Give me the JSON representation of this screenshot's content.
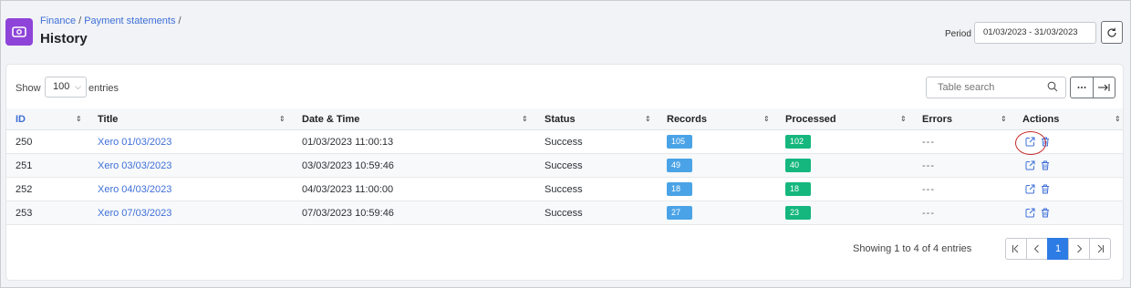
{
  "header": {
    "breadcrumb": [
      "Finance",
      "Payment statements"
    ],
    "title": "History",
    "period_label": "Period",
    "period_value": "01/03/2023 - 31/03/2023"
  },
  "toolbar": {
    "show_label": "Show",
    "entries_value": "100",
    "entries_label": "entries",
    "search_placeholder": "Table search"
  },
  "table": {
    "columns": [
      "ID",
      "Title",
      "Date & Time",
      "Status",
      "Records",
      "Processed",
      "Errors",
      "Actions"
    ],
    "rows": [
      {
        "id": "250",
        "title": "Xero 01/03/2023",
        "datetime": "01/03/2023 11:00:13",
        "status": "Success",
        "records": "105",
        "processed": "102",
        "errors": "---"
      },
      {
        "id": "251",
        "title": "Xero 03/03/2023",
        "datetime": "03/03/2023 10:59:46",
        "status": "Success",
        "records": "49",
        "processed": "40",
        "errors": "---"
      },
      {
        "id": "252",
        "title": "Xero 04/03/2023",
        "datetime": "04/03/2023 11:00:00",
        "status": "Success",
        "records": "18",
        "processed": "18",
        "errors": "---"
      },
      {
        "id": "253",
        "title": "Xero 07/03/2023",
        "datetime": "07/03/2023 10:59:46",
        "status": "Success",
        "records": "27",
        "processed": "23",
        "errors": "---"
      }
    ]
  },
  "footer": {
    "showing": "Showing 1 to 4 of 4 entries",
    "current_page": "1"
  },
  "colors": {
    "accent": "#2d7be5",
    "link": "#3f6fd8",
    "records_badge": "#4aa3e6",
    "processed_badge": "#15b77e",
    "app_icon": "#8e44d8",
    "highlight": "#c62828"
  },
  "icons": [
    "finance-icon",
    "refresh-icon",
    "search-icon",
    "more-icon",
    "expand-icon",
    "open-external-icon",
    "delete-icon",
    "first-page-icon",
    "prev-page-icon",
    "next-page-icon",
    "last-page-icon"
  ]
}
